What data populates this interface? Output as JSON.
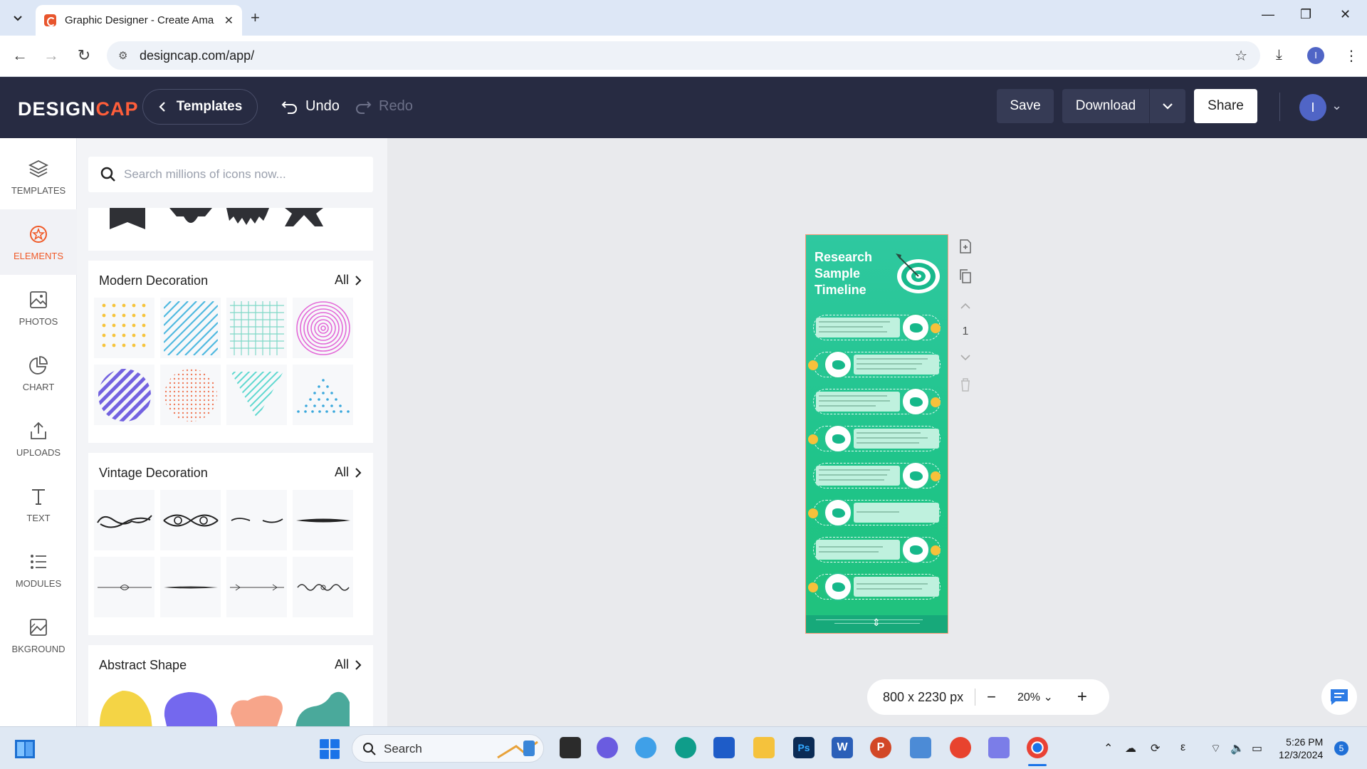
{
  "browser": {
    "tab_title": "Graphic Designer - Create Amazing",
    "url": "designcap.com/app/",
    "profile_initial": "I"
  },
  "header": {
    "logo_design": "DESIGN",
    "logo_cap": "CAP",
    "templates_label": "Templates",
    "undo_label": "Undo",
    "redo_label": "Redo",
    "save_label": "Save",
    "download_label": "Download",
    "share_label": "Share",
    "user_initial": "I"
  },
  "rail": {
    "items": [
      {
        "label": "TEMPLATES",
        "icon": "layers-icon"
      },
      {
        "label": "ELEMENTS",
        "icon": "elements-icon",
        "active": true
      },
      {
        "label": "PHOTOS",
        "icon": "photo-icon"
      },
      {
        "label": "CHART",
        "icon": "pie-chart-icon"
      },
      {
        "label": "UPLOADS",
        "icon": "upload-icon"
      },
      {
        "label": "TEXT",
        "icon": "text-icon"
      },
      {
        "label": "MODULES",
        "icon": "list-icon"
      },
      {
        "label": "BKGROUND",
        "icon": "background-icon"
      }
    ]
  },
  "panel": {
    "search_placeholder": "Search millions of icons now...",
    "sections": [
      {
        "title": "Modern Decoration",
        "all_label": "All"
      },
      {
        "title": "Vintage Decoration",
        "all_label": "All"
      },
      {
        "title": "Abstract Shape",
        "all_label": "All"
      }
    ]
  },
  "canvas": {
    "poster_title": "Research Sample Timeline",
    "page_number": "1",
    "dimensions": "800 x 2230 px",
    "zoom": "20%"
  },
  "taskbar": {
    "search_label": "Search",
    "time": "5:26 PM",
    "date": "12/3/2024",
    "notifications": "5"
  },
  "colors": {
    "header_bg": "#272b42",
    "accent": "#f05a28",
    "poster_green": "#1fc489"
  }
}
